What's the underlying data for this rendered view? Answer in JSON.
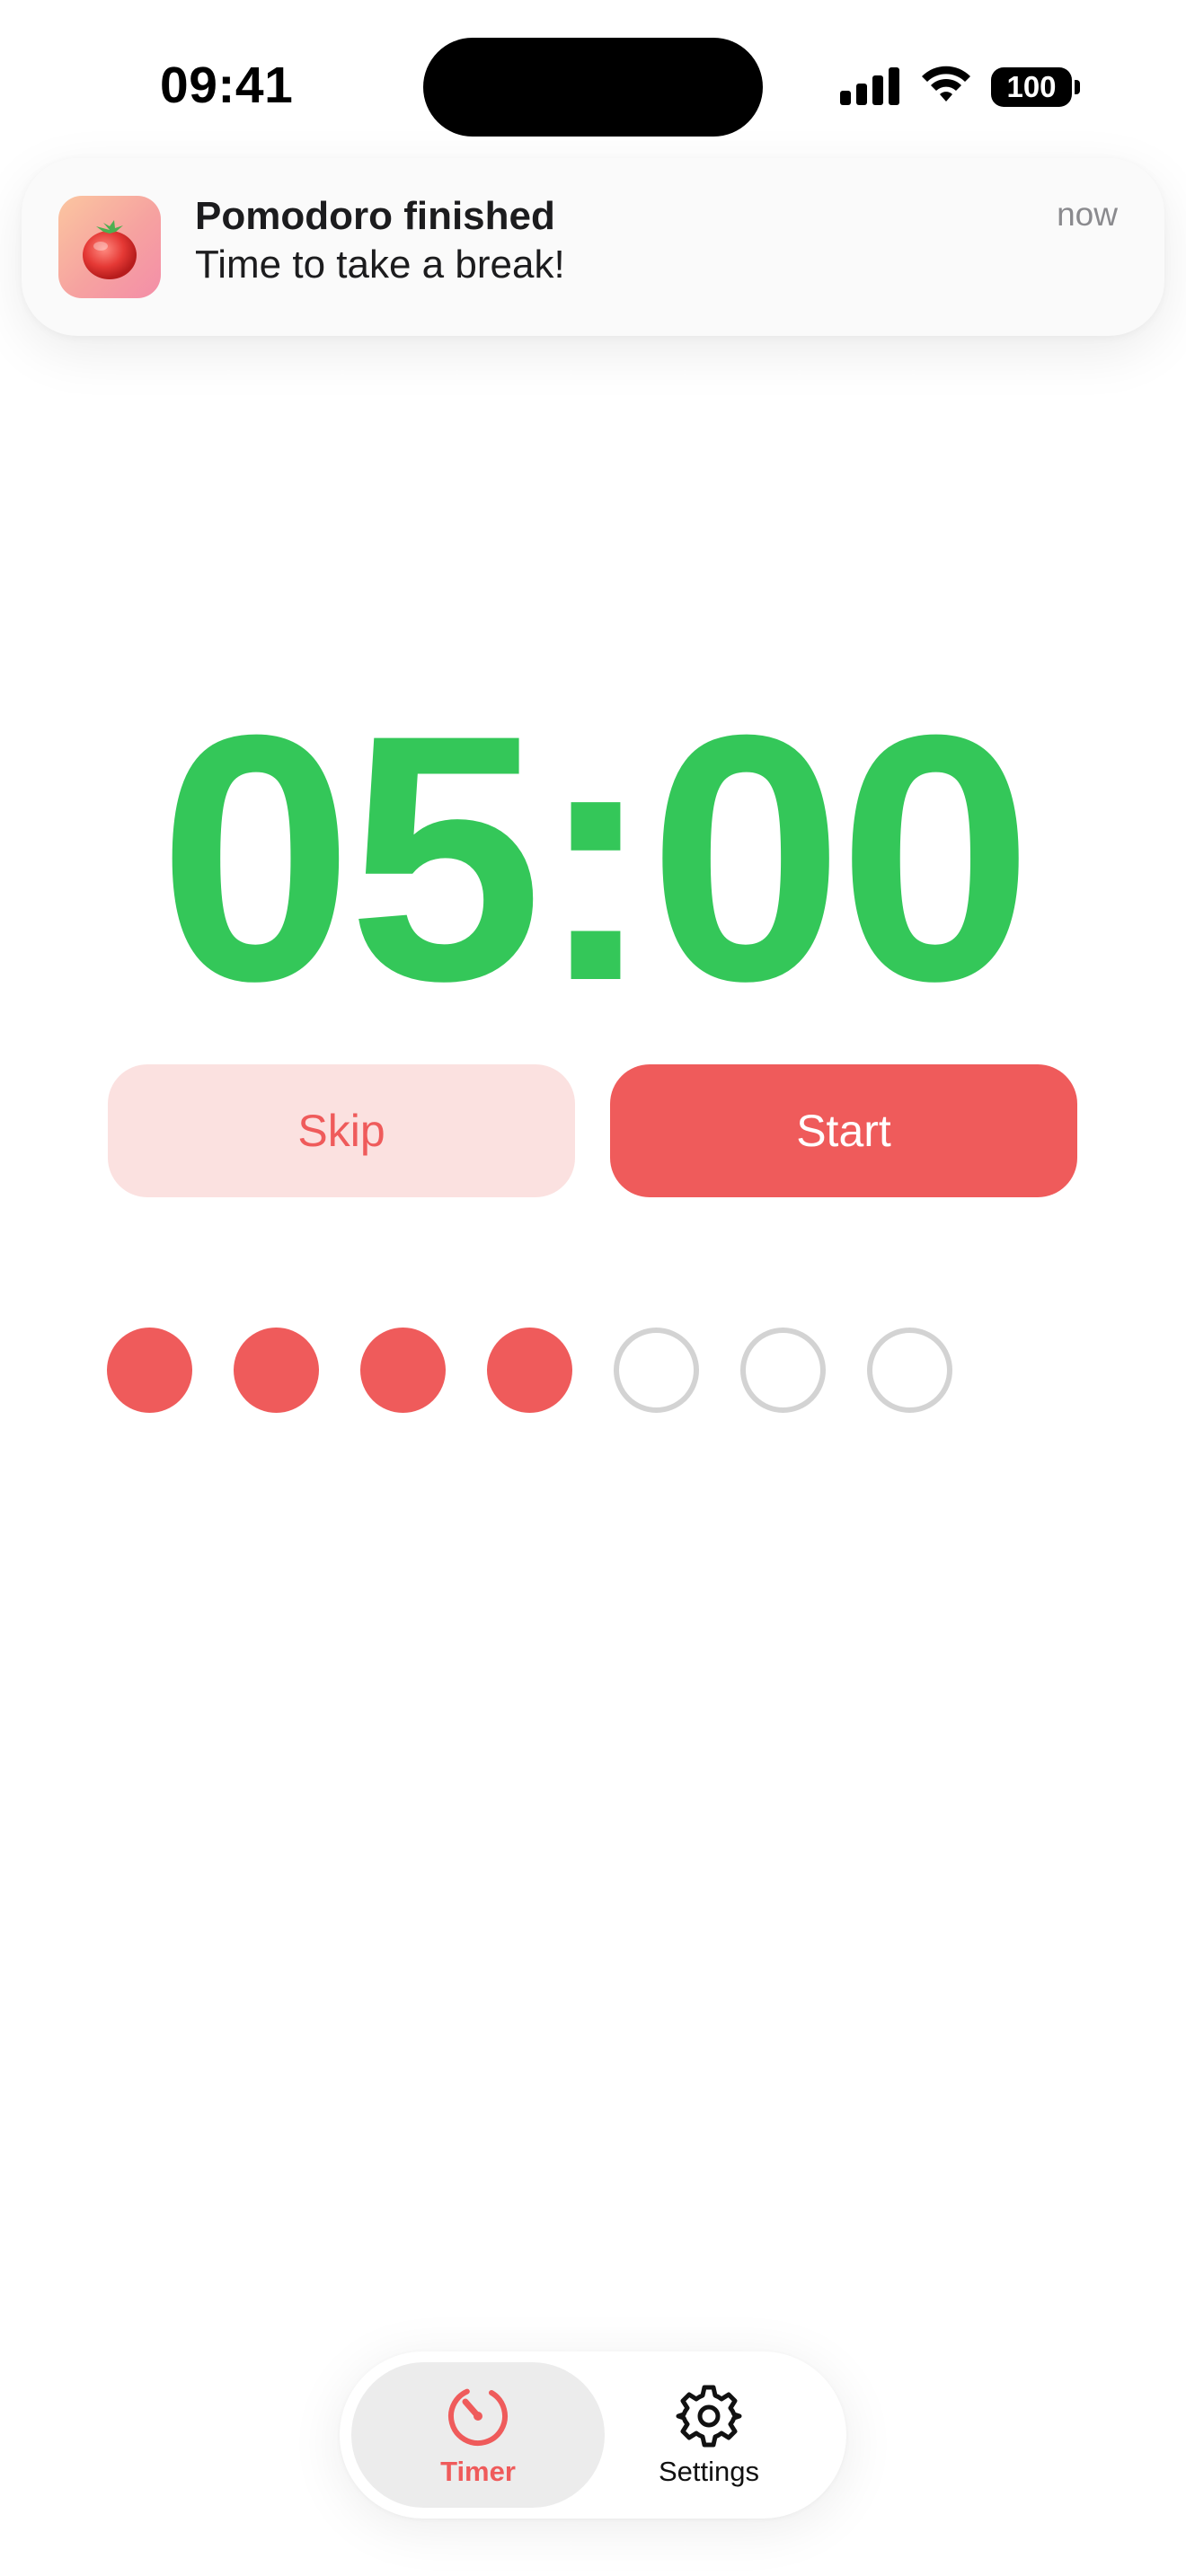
{
  "status_bar": {
    "time": "09:41",
    "battery": "100"
  },
  "notification": {
    "title": "Pomodoro finished",
    "body": "Time to take a break!",
    "time": "now",
    "app_icon": "tomato-icon"
  },
  "timer": {
    "display": "05:00",
    "color": "#34c759"
  },
  "actions": {
    "skip_label": "Skip",
    "start_label": "Start"
  },
  "progress": {
    "completed": 4,
    "total": 7,
    "filled_color": "#ef5b5b",
    "empty_color": "#d3d3d3"
  },
  "tabbar": {
    "tabs": [
      {
        "label": "Timer",
        "icon": "timer-icon",
        "active": true
      },
      {
        "label": "Settings",
        "icon": "gear-icon",
        "active": false
      }
    ]
  },
  "colors": {
    "accent": "#ef5b5b",
    "skip_bg": "#fbe1e0"
  }
}
